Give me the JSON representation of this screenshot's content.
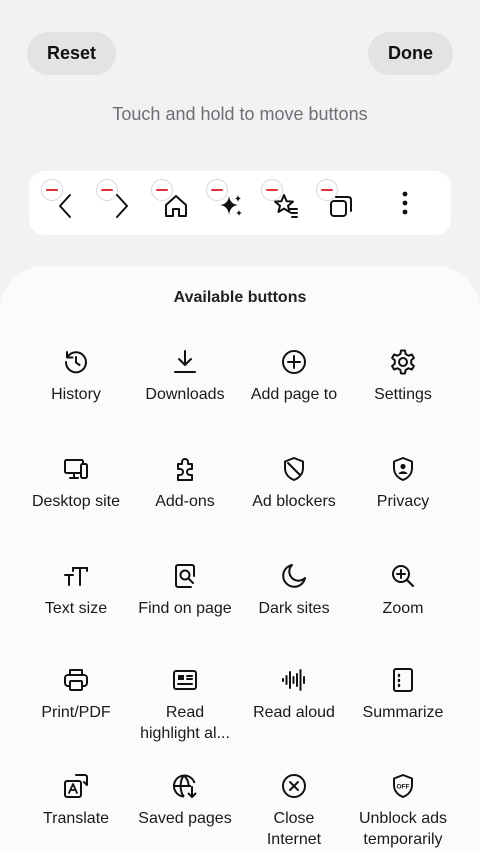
{
  "header": {
    "reset_label": "Reset",
    "done_label": "Done",
    "hint": "Touch and hold to move buttons"
  },
  "toolbar": {
    "items": [
      {
        "icon": "back-icon"
      },
      {
        "icon": "forward-icon"
      },
      {
        "icon": "home-icon"
      },
      {
        "icon": "ai-sparkle-icon"
      },
      {
        "icon": "bookmarks-icon"
      },
      {
        "icon": "tabs-icon"
      },
      {
        "icon": "more-vertical-icon"
      }
    ],
    "remove_color": "#e0313a"
  },
  "available": {
    "title": "Available buttons",
    "items": [
      {
        "label": "History",
        "icon": "history-icon"
      },
      {
        "label": "Downloads",
        "icon": "download-icon"
      },
      {
        "label": "Add page to",
        "icon": "add-icon"
      },
      {
        "label": "Settings",
        "icon": "gear-icon"
      },
      {
        "label": "Desktop site",
        "icon": "desktop-icon"
      },
      {
        "label": "Add-ons",
        "icon": "puzzle-icon"
      },
      {
        "label": "Ad blockers",
        "icon": "shield-icon"
      },
      {
        "label": "Privacy",
        "icon": "privacy-shield-icon"
      },
      {
        "label": "Text size",
        "icon": "text-size-icon"
      },
      {
        "label": "Find on page",
        "icon": "find-icon"
      },
      {
        "label": "Dark sites",
        "icon": "moon-icon"
      },
      {
        "label": "Zoom",
        "icon": "zoom-icon"
      },
      {
        "label": "Print/PDF",
        "icon": "print-icon"
      },
      {
        "label": "Read\nhighlight al...",
        "icon": "read-highlight-icon"
      },
      {
        "label": "Read aloud",
        "icon": "waveform-icon"
      },
      {
        "label": "Summarize",
        "icon": "summarize-icon"
      },
      {
        "label": "Translate",
        "icon": "translate-icon"
      },
      {
        "label": "Saved pages",
        "icon": "saved-pages-icon"
      },
      {
        "label": "Close\nInternet",
        "icon": "close-circle-icon"
      },
      {
        "label": "Unblock ads\ntemporarily",
        "icon": "ads-off-icon"
      }
    ]
  }
}
